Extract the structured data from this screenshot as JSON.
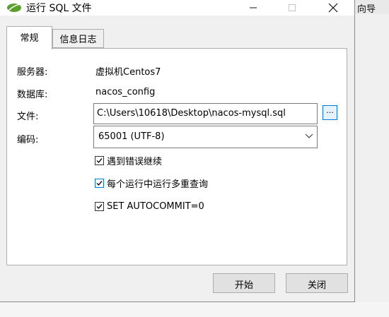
{
  "window": {
    "title": "运行 SQL 文件",
    "background_text": "向导"
  },
  "tabs": [
    {
      "label": "常规",
      "active": true
    },
    {
      "label": "信息日志",
      "active": false
    }
  ],
  "form": {
    "server_label": "服务器:",
    "server_value": "虚拟机Centos7",
    "database_label": "数据库:",
    "database_value": "nacos_config",
    "file_label": "文件:",
    "file_value": "C:\\Users\\10618\\Desktop\\nacos-mysql.sql",
    "browse_label": "...",
    "encoding_label": "编码:",
    "encoding_value": "65001 (UTF-8)"
  },
  "options": [
    {
      "label": "遇到错误继续",
      "checked": true
    },
    {
      "label": "每个运行中运行多重查询",
      "checked": true
    },
    {
      "label": "SET AUTOCOMMIT=0",
      "checked": true
    }
  ],
  "buttons": {
    "start": "开始",
    "close": "关闭"
  },
  "colors": {
    "accent": "#0078d7",
    "icon_green": "#5aa02c"
  }
}
